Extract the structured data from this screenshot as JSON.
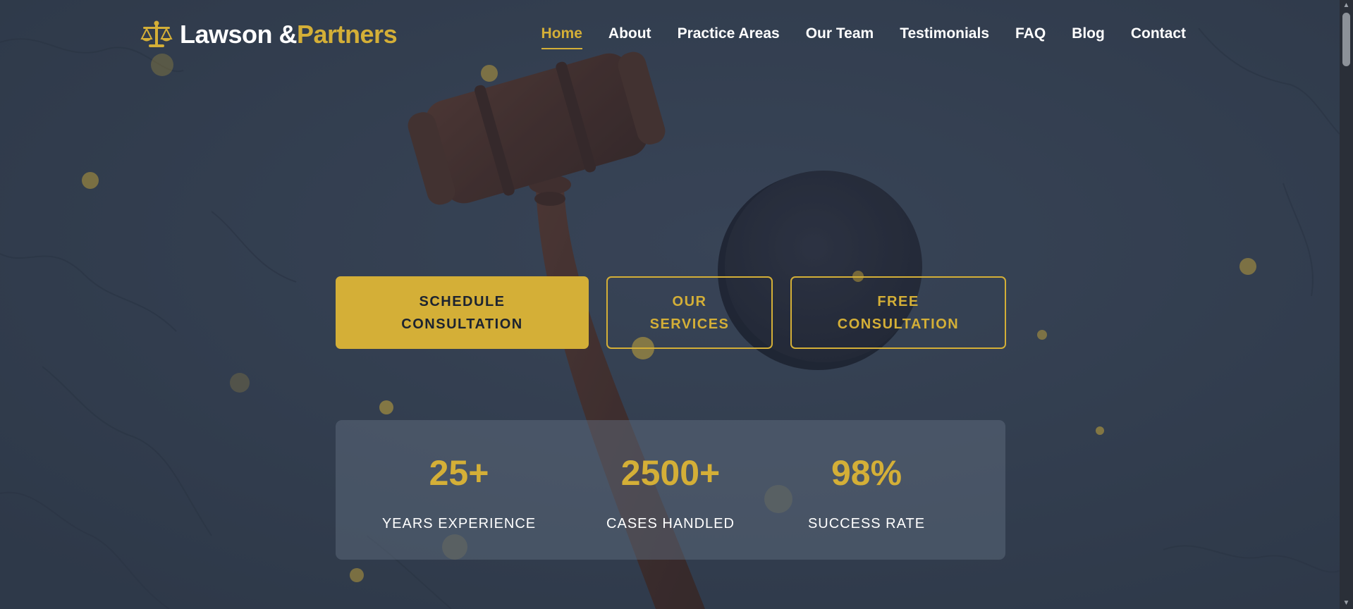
{
  "header": {
    "logo_name": "Lawson &",
    "logo_name2": "Partners",
    "logo_icon": "scales-icon"
  },
  "nav": {
    "items": [
      {
        "label": "Home",
        "active": true
      },
      {
        "label": "About",
        "active": false
      },
      {
        "label": "Practice Areas",
        "active": false
      },
      {
        "label": "Our Team",
        "active": false
      },
      {
        "label": "Testimonials",
        "active": false
      },
      {
        "label": "FAQ",
        "active": false
      },
      {
        "label": "Blog",
        "active": false
      },
      {
        "label": "Contact",
        "active": false
      }
    ]
  },
  "cta": {
    "schedule_line1": "SCHEDULE",
    "schedule_line2": "CONSULTATION",
    "services_line1": "OUR",
    "services_line2": "SERVICES",
    "free_line1": "FREE",
    "free_line2": "CONSULTATION"
  },
  "stats": [
    {
      "value": "25+",
      "label": "YEARS EXPERIENCE"
    },
    {
      "value": "2500+",
      "label": "CASES HANDLED"
    },
    {
      "value": "98%",
      "label": "SUCCESS RATE"
    }
  ],
  "colors": {
    "accent": "#d4af37",
    "background": "#35404f",
    "text": "#ffffff"
  }
}
